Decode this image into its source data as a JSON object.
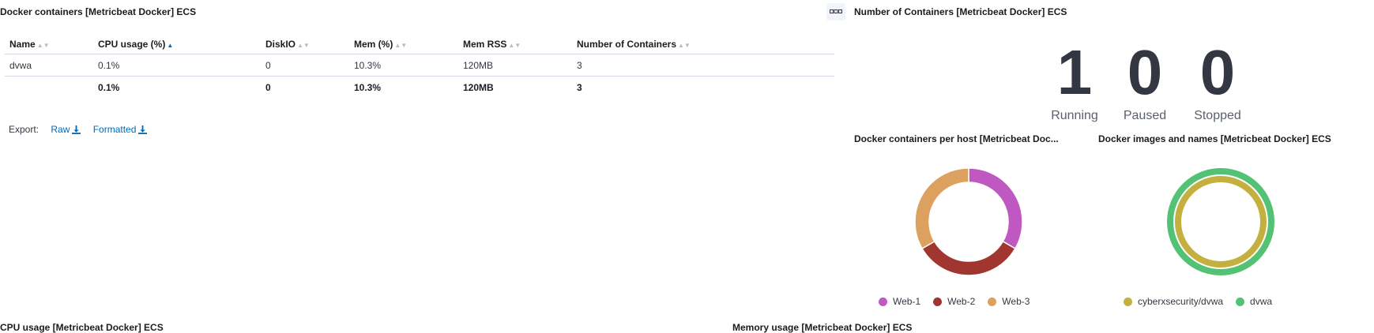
{
  "left_panel": {
    "title": "Docker containers [Metricbeat Docker] ECS",
    "columns": [
      "Name",
      "CPU usage (%)",
      "DiskIO",
      "Mem (%)",
      "Mem RSS",
      "Number of Containers"
    ],
    "rows": [
      [
        "dvwa",
        "0.1%",
        "0",
        "10.3%",
        "120MB",
        "3"
      ]
    ],
    "totals": [
      "",
      "0.1%",
      "0",
      "10.3%",
      "120MB",
      "3"
    ],
    "export_label": "Export:",
    "export_raw": "Raw",
    "export_formatted": "Formatted"
  },
  "containers_panel": {
    "title": "Number of Containers [Metricbeat Docker] ECS",
    "metrics": [
      {
        "value": "1",
        "label": "Running"
      },
      {
        "value": "0",
        "label": "Paused"
      },
      {
        "value": "0",
        "label": "Stopped"
      }
    ]
  },
  "per_host_panel": {
    "title": "Docker containers per host [Metricbeat Doc...",
    "legend": [
      {
        "label": "Web-1",
        "color": "#c058c2"
      },
      {
        "label": "Web-2",
        "color": "#a13530"
      },
      {
        "label": "Web-3",
        "color": "#dca05f"
      }
    ]
  },
  "images_panel": {
    "title": "Docker images and names [Metricbeat Docker] ECS",
    "legend": [
      {
        "label": "cyberxsecurity/dvwa",
        "color": "#c3b03e"
      },
      {
        "label": "dvwa",
        "color": "#54c274"
      }
    ]
  },
  "bottom": {
    "cpu_title": "CPU usage [Metricbeat Docker] ECS",
    "mem_title": "Memory usage [Metricbeat Docker] ECS"
  },
  "chart_data": [
    {
      "type": "pie",
      "categories": [
        "Web-1",
        "Web-2",
        "Web-3"
      ],
      "values": [
        1,
        1,
        1
      ],
      "donut": true
    },
    {
      "type": "pie",
      "rings": [
        {
          "categories": [
            "cyberxsecurity/dvwa"
          ],
          "values": [
            1
          ]
        },
        {
          "categories": [
            "dvwa"
          ],
          "values": [
            1
          ]
        }
      ],
      "donut": true
    }
  ]
}
